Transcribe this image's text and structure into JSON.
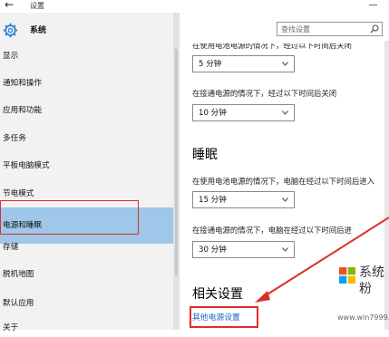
{
  "window": {
    "title": "设置"
  },
  "sidebar": {
    "header": "系统",
    "items": [
      "显示",
      "通知和操作",
      "应用和功能",
      "多任务",
      "平板电脑模式",
      "节电模式",
      "电源和睡眠",
      "存储",
      "脱机地图",
      "默认应用",
      "关于"
    ],
    "active_index": 6
  },
  "search": {
    "placeholder": "查找设置"
  },
  "screen": {
    "battery_label": "在使用电池电源的情况下，经过以下时间后关闭",
    "battery_value": "5 分钟",
    "plugged_label": "在接通电源的情况下，经过以下时间后关闭",
    "plugged_value": "10 分钟"
  },
  "sleep": {
    "title": "睡眠",
    "battery_label": "在使用电池电源的情况下，电脑在经过以下时间后进入",
    "battery_value": "15 分钟",
    "plugged_label": "在接通电源的情况下，电脑在经过以下时间后进",
    "plugged_value": "30 分钟"
  },
  "related": {
    "title": "相关设置",
    "link": "其他电源设置"
  },
  "watermark": {
    "brand": "系统粉",
    "url": "www.win7999.com"
  },
  "colors": {
    "accent_selected": "#9ec7e9",
    "annotation_red": "#d9302c",
    "link_blue": "#1e64c8"
  }
}
